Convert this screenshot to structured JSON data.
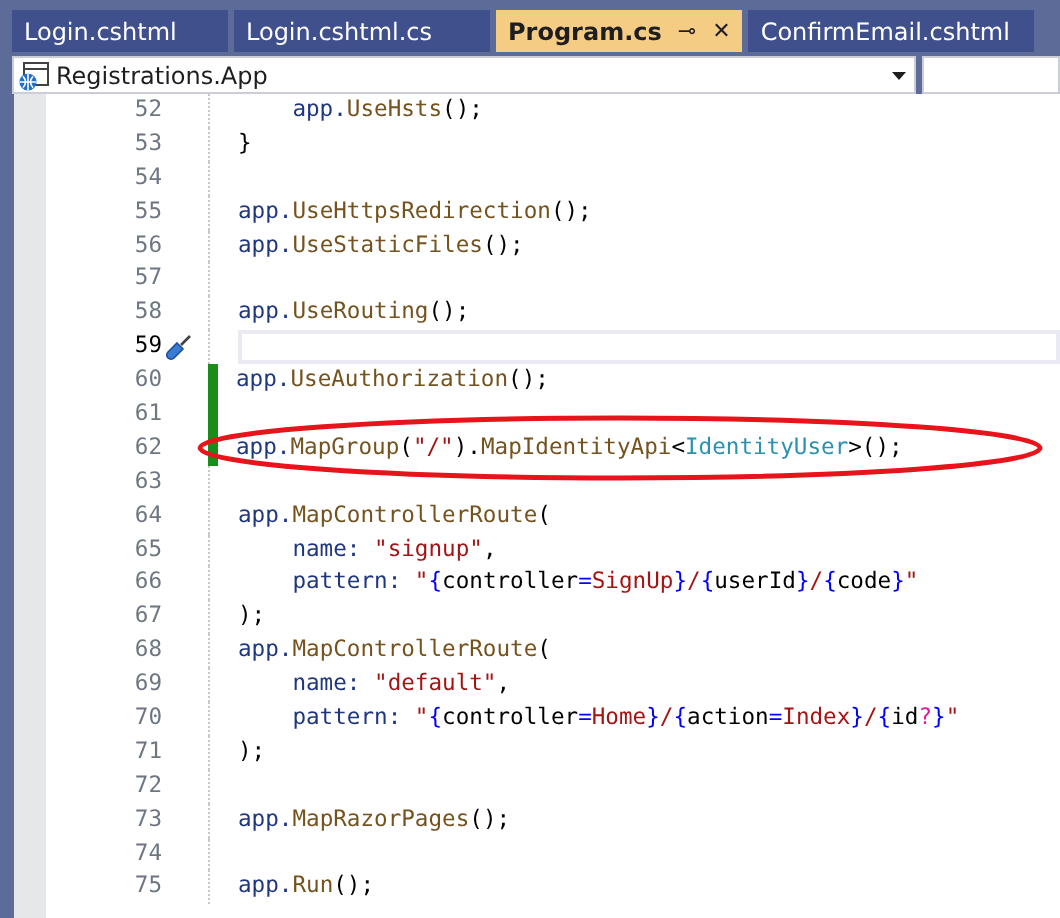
{
  "tabs": [
    {
      "label": "Login.cshtml",
      "selected": false
    },
    {
      "label": "Login.cshtml.cs",
      "selected": false
    },
    {
      "label": "Program.cs",
      "selected": true
    },
    {
      "label": "ConfirmEmail.cshtml",
      "selected": false
    }
  ],
  "tab_actions": {
    "pin": "⊸",
    "close": "✕"
  },
  "navigation_bar": {
    "project": "Registrations.App"
  },
  "lines": [
    {
      "number": "52",
      "current": false,
      "changed": false,
      "circled": false,
      "tokens": [
        {
          "text": "    app.",
          "kind": "var"
        },
        {
          "text": "UseHsts",
          "kind": "method"
        },
        {
          "text": "();",
          "kind": "punct"
        }
      ]
    },
    {
      "number": "53",
      "current": false,
      "changed": false,
      "circled": false,
      "tokens": [
        {
          "text": "}",
          "kind": "punct"
        }
      ]
    },
    {
      "number": "54",
      "current": false,
      "changed": false,
      "circled": false
    },
    {
      "number": "55",
      "current": false,
      "changed": false,
      "circled": false,
      "tokens": [
        {
          "text": "app.",
          "kind": "var"
        },
        {
          "text": "UseHttpsRedirection",
          "kind": "method"
        },
        {
          "text": "();",
          "kind": "punct"
        }
      ]
    },
    {
      "number": "56",
      "current": false,
      "changed": false,
      "circled": false,
      "tokens": [
        {
          "text": "app.",
          "kind": "var"
        },
        {
          "text": "UseStaticFiles",
          "kind": "method"
        },
        {
          "text": "();",
          "kind": "punct"
        }
      ]
    },
    {
      "number": "57",
      "current": false,
      "changed": false,
      "circled": false
    },
    {
      "number": "58",
      "current": false,
      "changed": false,
      "circled": false,
      "tokens": [
        {
          "text": "app.",
          "kind": "var"
        },
        {
          "text": "UseRouting",
          "kind": "method"
        },
        {
          "text": "();",
          "kind": "punct"
        }
      ]
    },
    {
      "number": "59",
      "current": true,
      "changed": false,
      "circled": false
    },
    {
      "number": "60",
      "current": false,
      "changed": true,
      "circled": false,
      "tokens": [
        {
          "text": "app.",
          "kind": "var"
        },
        {
          "text": "UseAuthorization",
          "kind": "method"
        },
        {
          "text": "();",
          "kind": "punct"
        }
      ]
    },
    {
      "number": "61",
      "current": false,
      "changed": true,
      "circled": false
    },
    {
      "number": "62",
      "current": false,
      "changed": true,
      "circled": true,
      "tokens": [
        {
          "text": "app.",
          "kind": "var"
        },
        {
          "text": "MapGroup",
          "kind": "method"
        },
        {
          "text": "(",
          "kind": "punct"
        },
        {
          "text": "\"/\"",
          "kind": "string"
        },
        {
          "text": ").",
          "kind": "punct"
        },
        {
          "text": "MapIdentityApi",
          "kind": "method"
        },
        {
          "text": "<",
          "kind": "punct"
        },
        {
          "text": "IdentityUser",
          "kind": "type"
        },
        {
          "text": ">();",
          "kind": "punct"
        }
      ]
    },
    {
      "number": "63",
      "current": false,
      "changed": false,
      "circled": false
    },
    {
      "number": "64",
      "current": false,
      "changed": false,
      "circled": false,
      "tokens": [
        {
          "text": "app.",
          "kind": "var"
        },
        {
          "text": "MapControllerRoute",
          "kind": "method"
        },
        {
          "text": "(",
          "kind": "punct"
        }
      ]
    },
    {
      "number": "65",
      "current": false,
      "changed": false,
      "circled": false,
      "tokens": [
        {
          "text": "    name: ",
          "kind": "var"
        },
        {
          "text": "\"signup\"",
          "kind": "string"
        },
        {
          "text": ",",
          "kind": "punct"
        }
      ]
    },
    {
      "number": "66",
      "current": false,
      "changed": false,
      "circled": false,
      "tokens": [
        {
          "text": "    pattern: ",
          "kind": "var"
        },
        {
          "text": "\"",
          "kind": "string"
        },
        {
          "text": "{",
          "kind": "route-brace"
        },
        {
          "text": "controller",
          "kind": "route-param"
        },
        {
          "text": "=",
          "kind": "route-brace"
        },
        {
          "text": "SignUp",
          "kind": "route-default"
        },
        {
          "text": "}",
          "kind": "route-brace"
        },
        {
          "text": "/",
          "kind": "string"
        },
        {
          "text": "{",
          "kind": "route-brace"
        },
        {
          "text": "userId",
          "kind": "route-param"
        },
        {
          "text": "}",
          "kind": "route-brace"
        },
        {
          "text": "/",
          "kind": "string"
        },
        {
          "text": "{",
          "kind": "route-brace"
        },
        {
          "text": "code",
          "kind": "route-param"
        },
        {
          "text": "}",
          "kind": "route-brace"
        },
        {
          "text": "\"",
          "kind": "string"
        }
      ]
    },
    {
      "number": "67",
      "current": false,
      "changed": false,
      "circled": false,
      "tokens": [
        {
          "text": ");",
          "kind": "punct"
        }
      ]
    },
    {
      "number": "68",
      "current": false,
      "changed": false,
      "circled": false,
      "tokens": [
        {
          "text": "app.",
          "kind": "var"
        },
        {
          "text": "MapControllerRoute",
          "kind": "method"
        },
        {
          "text": "(",
          "kind": "punct"
        }
      ]
    },
    {
      "number": "69",
      "current": false,
      "changed": false,
      "circled": false,
      "tokens": [
        {
          "text": "    name: ",
          "kind": "var"
        },
        {
          "text": "\"default\"",
          "kind": "string"
        },
        {
          "text": ",",
          "kind": "punct"
        }
      ]
    },
    {
      "number": "70",
      "current": false,
      "changed": false,
      "circled": false,
      "tokens": [
        {
          "text": "    pattern: ",
          "kind": "var"
        },
        {
          "text": "\"",
          "kind": "string"
        },
        {
          "text": "{",
          "kind": "route-brace"
        },
        {
          "text": "controller",
          "kind": "route-param"
        },
        {
          "text": "=",
          "kind": "route-brace"
        },
        {
          "text": "Home",
          "kind": "route-default"
        },
        {
          "text": "}",
          "kind": "route-brace"
        },
        {
          "text": "/",
          "kind": "string"
        },
        {
          "text": "{",
          "kind": "route-brace"
        },
        {
          "text": "action",
          "kind": "route-param"
        },
        {
          "text": "=",
          "kind": "route-brace"
        },
        {
          "text": "Index",
          "kind": "route-default"
        },
        {
          "text": "}",
          "kind": "route-brace"
        },
        {
          "text": "/",
          "kind": "string"
        },
        {
          "text": "{",
          "kind": "route-brace"
        },
        {
          "text": "id",
          "kind": "route-param"
        },
        {
          "text": "?",
          "kind": "route-optional"
        },
        {
          "text": "}",
          "kind": "route-brace"
        },
        {
          "text": "\"",
          "kind": "string"
        }
      ]
    },
    {
      "number": "71",
      "current": false,
      "changed": false,
      "circled": false,
      "tokens": [
        {
          "text": ");",
          "kind": "punct"
        }
      ]
    },
    {
      "number": "72",
      "current": false,
      "changed": false,
      "circled": false
    },
    {
      "number": "73",
      "current": false,
      "changed": false,
      "circled": false,
      "tokens": [
        {
          "text": "app.",
          "kind": "var"
        },
        {
          "text": "MapRazorPages",
          "kind": "method"
        },
        {
          "text": "();",
          "kind": "punct"
        }
      ]
    },
    {
      "number": "74",
      "current": false,
      "changed": false,
      "circled": false
    },
    {
      "number": "75",
      "current": false,
      "changed": false,
      "circled": false,
      "tokens": [
        {
          "text": "app.",
          "kind": "var"
        },
        {
          "text": "Run",
          "kind": "method"
        },
        {
          "text": "();",
          "kind": "punct"
        }
      ]
    }
  ]
}
